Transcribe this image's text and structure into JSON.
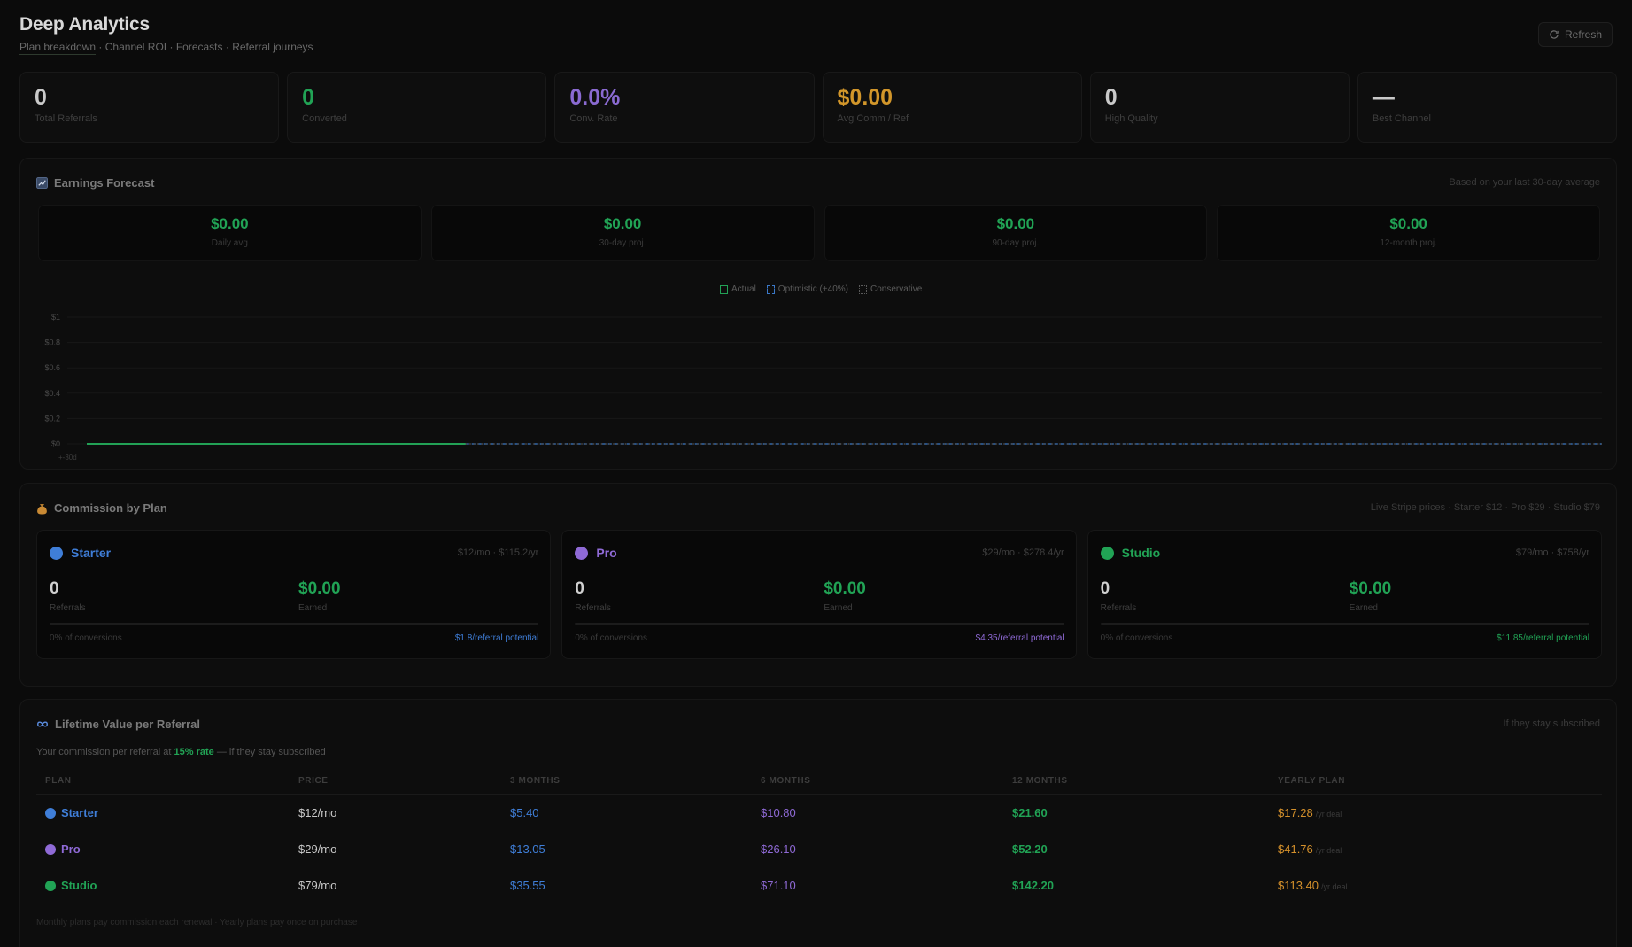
{
  "header": {
    "title": "Deep Analytics",
    "subtitle_items": [
      "Plan breakdown",
      "Channel ROI",
      "Forecasts",
      "Referral journeys"
    ],
    "refresh_label": "Refresh",
    "refresh_icon": "refresh-icon"
  },
  "stats": [
    {
      "value": "0",
      "label": "Total Referrals",
      "color": "#c9c9c9"
    },
    {
      "value": "0",
      "label": "Converted",
      "color": "#21a355"
    },
    {
      "value": "0.0%",
      "label": "Conv. Rate",
      "color": "#8a6ad1"
    },
    {
      "value": "$0.00",
      "label": "Avg Comm / Ref",
      "color": "#d2962a"
    },
    {
      "value": "0",
      "label": "High Quality",
      "color": "#c9c9c9"
    },
    {
      "value": "—",
      "label": "Best Channel",
      "color": "#c9c9c9"
    }
  ],
  "forecast": {
    "title": "Earnings Forecast",
    "icon": "chart-icon",
    "note": "Based on your last 30-day average",
    "cards": [
      {
        "value": "$0.00",
        "label": "Daily avg"
      },
      {
        "value": "$0.00",
        "label": "30-day proj."
      },
      {
        "value": "$0.00",
        "label": "90-day proj."
      },
      {
        "value": "$0.00",
        "label": "12-month proj."
      }
    ],
    "legend": {
      "actual": "Actual",
      "optimistic": "Optimistic (+40%)",
      "conservative": "Conservative"
    }
  },
  "chart_data": {
    "type": "line",
    "title": "",
    "xlabel": "",
    "ylabel": "",
    "y_ticks": [
      "$1",
      "$0.8",
      "$0.6",
      "$0.4",
      "$0.2",
      "$0"
    ],
    "ylim": [
      0,
      1
    ],
    "x_tick_label": "+-30d",
    "grid": true,
    "legend_position": "top-center",
    "series": [
      {
        "name": "Actual",
        "style": "solid",
        "color": "#22a155",
        "values": [
          0,
          0
        ],
        "x_range_fraction": [
          0,
          0.25
        ]
      },
      {
        "name": "Optimistic (+40%)",
        "style": "dashed",
        "color": "#3a78c8",
        "values": [
          0,
          0
        ],
        "x_range_fraction": [
          0.25,
          1
        ]
      },
      {
        "name": "Conservative",
        "style": "dotted",
        "color": "#5a5a5a",
        "values": [
          0,
          0
        ],
        "x_range_fraction": [
          0.25,
          1
        ]
      }
    ]
  },
  "commission": {
    "title": "Commission by Plan",
    "icon": "money-bag-icon",
    "note": "Live Stripe prices · Starter $12 · Pro $29 · Studio $79",
    "plans": [
      {
        "name": "Starter",
        "color": "#3f7ed8",
        "price": "$12/mo · $115.2/yr",
        "referrals": "0",
        "referrals_label": "Referrals",
        "earned": "$0.00",
        "earned_label": "Earned",
        "conversions": "0% of conversions",
        "potential": "$1.8/referral potential"
      },
      {
        "name": "Pro",
        "color": "#8f6ad6",
        "price": "$29/mo · $278.4/yr",
        "referrals": "0",
        "referrals_label": "Referrals",
        "earned": "$0.00",
        "earned_label": "Earned",
        "conversions": "0% of conversions",
        "potential": "$4.35/referral potential"
      },
      {
        "name": "Studio",
        "color": "#21a355",
        "price": "$79/mo · $758/yr",
        "referrals": "0",
        "referrals_label": "Referrals",
        "earned": "$0.00",
        "earned_label": "Earned",
        "conversions": "0% of conversions",
        "potential": "$11.85/referral potential"
      }
    ]
  },
  "ltv": {
    "title": "Lifetime Value per Referral",
    "icon": "infinity-icon",
    "note": "If they stay subscribed",
    "desc_prefix": "Your commission per referral at",
    "desc_rate": "15% rate",
    "desc_suffix": "— if they stay subscribed",
    "columns": [
      "PLAN",
      "PRICE",
      "3 MONTHS",
      "6 MONTHS",
      "12 MONTHS",
      "YEARLY PLAN"
    ],
    "rows": [
      {
        "plan": "Starter",
        "color": "#3f7ed8",
        "price": "$12/mo",
        "m3": "$5.40",
        "m6": "$10.80",
        "m12": "$21.60",
        "yearly": "$17.28",
        "yearly_suffix": "/yr deal"
      },
      {
        "plan": "Pro",
        "color": "#8f6ad6",
        "price": "$29/mo",
        "m3": "$13.05",
        "m6": "$26.10",
        "m12": "$52.20",
        "yearly": "$41.76",
        "yearly_suffix": "/yr deal"
      },
      {
        "plan": "Studio",
        "color": "#21a355",
        "price": "$79/mo",
        "m3": "$35.55",
        "m6": "$71.10",
        "m12": "$142.20",
        "yearly": "$113.40",
        "yearly_suffix": "/yr deal"
      }
    ],
    "footer": "Monthly plans pay commission each renewal · Yearly plans pay once on purchase"
  }
}
